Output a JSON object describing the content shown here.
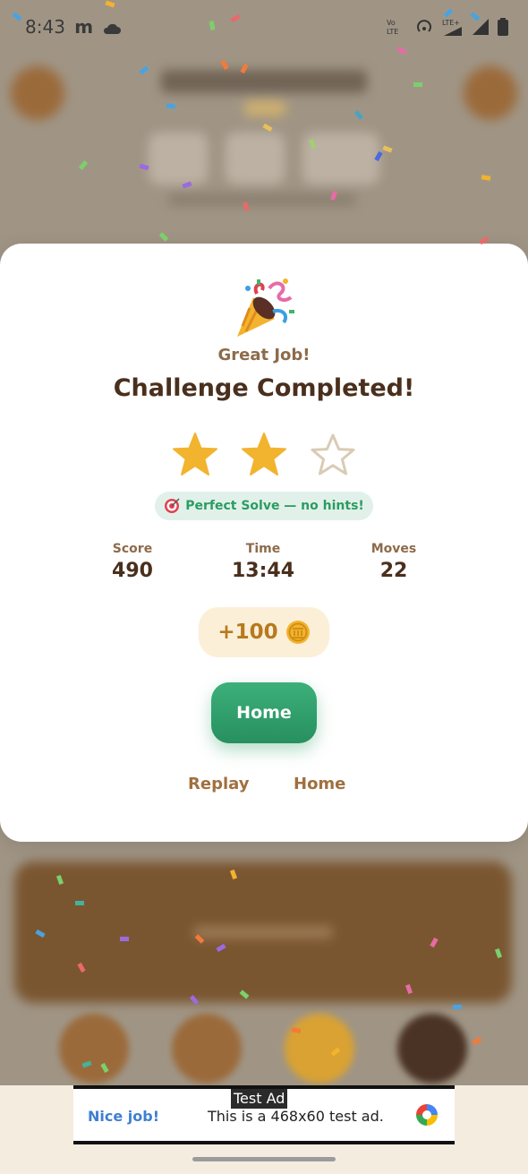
{
  "status_bar": {
    "time": "8:43",
    "carrier_glyph": "m"
  },
  "modal": {
    "subtitle": "Great Job!",
    "title": "Challenge Completed!",
    "stars_earned": 2,
    "stars_total": 3,
    "badge": "Perfect Solve — no hints!",
    "stats": [
      {
        "label": "Score",
        "value": "490"
      },
      {
        "label": "Time",
        "value": "13:44"
      },
      {
        "label": "Moves",
        "value": "22"
      }
    ],
    "reward": "+100",
    "primary_button": "Home",
    "secondary_left": "Replay",
    "secondary_right": "Home"
  },
  "ad": {
    "tag": "Test Ad",
    "headline": "Nice job!",
    "body": "This is a 468x60 test ad."
  },
  "colors": {
    "accent_green": "#2b9c62",
    "title_brown": "#4a2f1d",
    "star_gold": "#f2b32e",
    "coin_text": "#b67a1f"
  }
}
